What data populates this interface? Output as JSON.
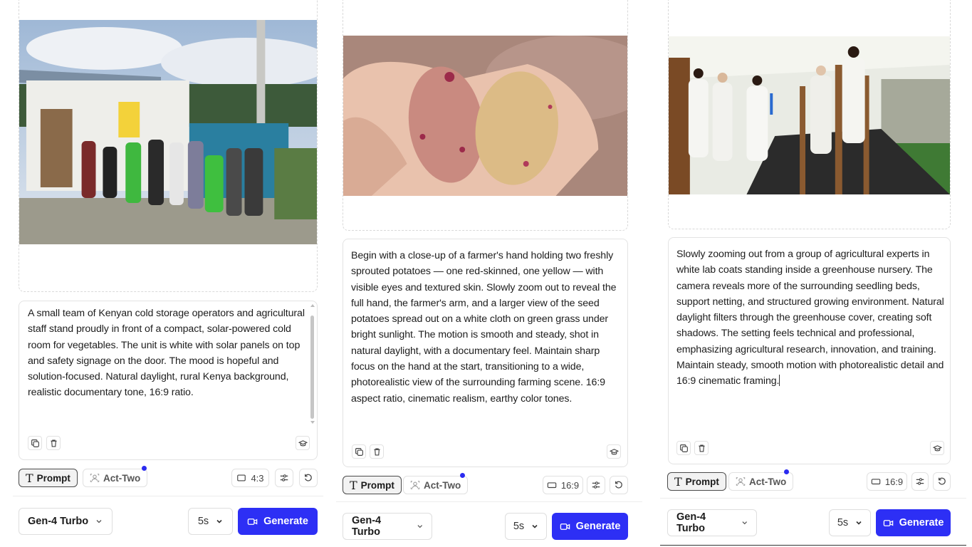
{
  "panels": [
    {
      "image_alt": "team in front of solar cold room",
      "prompt": "A small team of Kenyan cold storage operators and agricultural staff stand proudly in front of a compact, solar-powered cold room for vegetables. The unit is white with solar panels on top and safety signage on the door. The mood is hopeful and solution-focused. Natural daylight, rural Kenya background, realistic documentary tone, 16:9 ratio.",
      "mode_prompt": "Prompt",
      "mode_act_two": "Act-Two",
      "aspect": "4:3",
      "model": "Gen-4 Turbo",
      "duration": "5s",
      "generate": "Generate"
    },
    {
      "image_alt": "hand holding two sprouted potatoes",
      "prompt": "Begin with a close-up of a farmer's hand holding two freshly sprouted potatoes — one red-skinned, one yellow — with visible eyes and textured skin. Slowly zoom out to reveal the full hand, the farmer's arm, and a larger view of the seed potatoes spread out on a white cloth on green grass under bright sunlight. The motion is smooth and steady, shot in natural daylight, with a documentary feel. Maintain sharp focus on the hand at the start, transitioning to a wide, photorealistic view of the surrounding farming scene. 16:9 aspect ratio, cinematic realism, earthy color tones.",
      "mode_prompt": "Prompt",
      "mode_act_two": "Act-Two",
      "aspect": "16:9",
      "model": "Gen-4 Turbo",
      "duration": "5s",
      "generate": "Generate"
    },
    {
      "image_alt": "experts in lab coats inside greenhouse nursery",
      "prompt": "Slowly zooming out from a group of agricultural experts in white lab coats standing inside a greenhouse nursery. The camera reveals more of the surrounding seedling beds, support netting, and structured growing environment. Natural daylight filters through the greenhouse cover, creating soft shadows. The setting feels technical and professional, emphasizing agricultural research, innovation, and training. Maintain steady, smooth motion with photorealistic detail and 16:9 cinematic framing.",
      "mode_prompt": "Prompt",
      "mode_act_two": "Act-Two",
      "aspect": "16:9",
      "model": "Gen-4 Turbo",
      "duration": "5s",
      "generate": "Generate"
    }
  ],
  "colors": {
    "accent": "#2d2ff5",
    "dot": "#2b2bf0"
  },
  "icons": [
    "copy-icon",
    "trash-icon",
    "mortarboard-icon",
    "text-t-icon",
    "act-two-icon",
    "aspect-icon",
    "settings-sliders-icon",
    "reset-icon",
    "chevron-down-icon",
    "video-camera-icon"
  ]
}
